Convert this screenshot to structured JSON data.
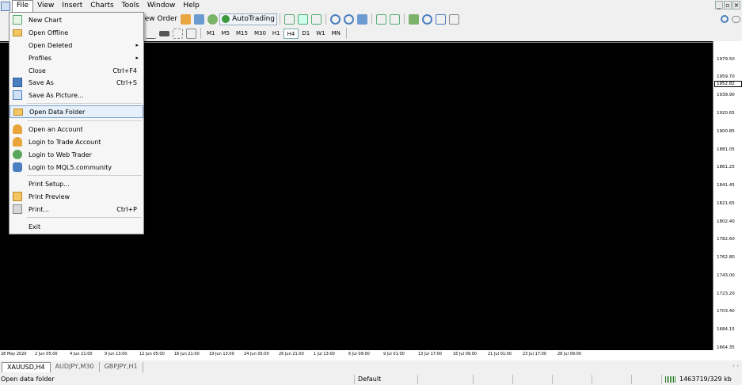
{
  "menubar": {
    "items": [
      {
        "label": "File",
        "active": true
      },
      {
        "label": "View"
      },
      {
        "label": "Insert"
      },
      {
        "label": "Charts"
      },
      {
        "label": "Tools"
      },
      {
        "label": "Window"
      },
      {
        "label": "Help"
      }
    ]
  },
  "toolbar": {
    "new_order": "New Order",
    "autotrading": "AutoTrading",
    "timeframes": [
      "M1",
      "M5",
      "M15",
      "M30",
      "H1",
      "H4",
      "D1",
      "W1",
      "MN"
    ],
    "selected_timeframe": "H4"
  },
  "file_menu": {
    "items": [
      {
        "label": "New Chart",
        "icon": "new-chart-icon"
      },
      {
        "label": "Open Offline",
        "icon": "folder-icon"
      },
      {
        "label": "Open Deleted",
        "submenu": true
      },
      {
        "label": "Profiles",
        "submenu": true
      },
      {
        "label": "Close",
        "shortcut": "Ctrl+F4"
      },
      {
        "label": "Save As",
        "shortcut": "Ctrl+S",
        "icon": "save-icon"
      },
      {
        "label": "Save As Picture...",
        "icon": "picture-icon"
      },
      {
        "label": "Open Data Folder",
        "icon": "folder-icon",
        "highlighted": true
      },
      {
        "label": "Open an Account",
        "icon": "account-icon"
      },
      {
        "label": "Login to Trade Account",
        "icon": "login-icon"
      },
      {
        "label": "Login to Web Trader",
        "icon": "web-trader-icon"
      },
      {
        "label": "Login to MQL5.community",
        "icon": "mql5-icon"
      },
      {
        "label": "Print Setup..."
      },
      {
        "label": "Print Preview",
        "icon": "print-preview-icon"
      },
      {
        "label": "Print...",
        "shortcut": "Ctrl+P",
        "icon": "printer-icon"
      },
      {
        "label": "Exit"
      }
    ]
  },
  "chart": {
    "current_price": "1952.82",
    "price_labels": [
      "1979.50",
      "1959.70",
      "1939.90",
      "1920.65",
      "1900.85",
      "1881.05",
      "1861.25",
      "1841.45",
      "1821.65",
      "1802.40",
      "1782.60",
      "1762.80",
      "1743.00",
      "1723.20",
      "1703.40",
      "1684.15",
      "1664.35"
    ],
    "time_labels": [
      "28 May 2020",
      "2 Jun 05:00",
      "4 Jun 21:00",
      "9 Jun 13:00",
      "12 Jun 05:00",
      "16 Jun 21:00",
      "19 Jun 13:00",
      "24 Jun 05:00",
      "26 Jun 21:00",
      "1 Jul 13:00",
      "6 Jul 09:00",
      "9 Jul 01:00",
      "13 Jul 17:00",
      "16 Jul 09:00",
      "21 Jul 01:00",
      "23 Jul 17:00",
      "28 Jul 09:00"
    ],
    "background": "#000000"
  },
  "tabs": [
    {
      "label": "XAUUSD,H4",
      "active": true
    },
    {
      "label": "AUDJPY,M30"
    },
    {
      "label": "GBPJPY,H1"
    }
  ],
  "status": {
    "hint": "Open data folder",
    "profile": "Default",
    "traffic": "1463719/329 kb"
  }
}
